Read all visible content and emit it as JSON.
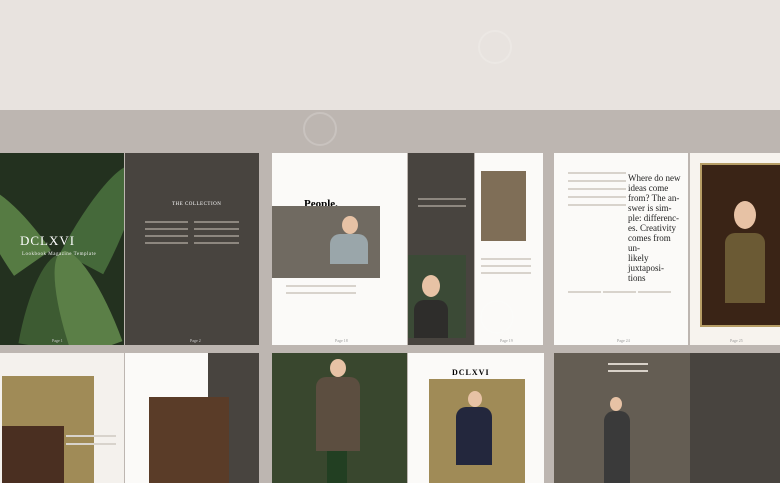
{
  "spread1": {
    "cover_title": "DCLXVI",
    "cover_subtitle": "Lookbook Magazine Template",
    "section_heading": "THE COLLECTION",
    "page_numbers": [
      "Page 1",
      "Page 2"
    ]
  },
  "spread2": {
    "people_heading": "People.",
    "page_numbers": [
      "Page 18",
      "Page 19"
    ]
  },
  "spread3": {
    "quote_lines": [
      "Where do new",
      "ideas come",
      "from? The an-",
      "swer is sim-",
      "ple: differenc-",
      "es. Creativity",
      "comes from un-",
      "likely juxtaposi-",
      "tions"
    ],
    "page_numbers": [
      "Page 24",
      "Page 25"
    ]
  },
  "spread_row2": {
    "olive_spread_title": "DCLXVI"
  }
}
